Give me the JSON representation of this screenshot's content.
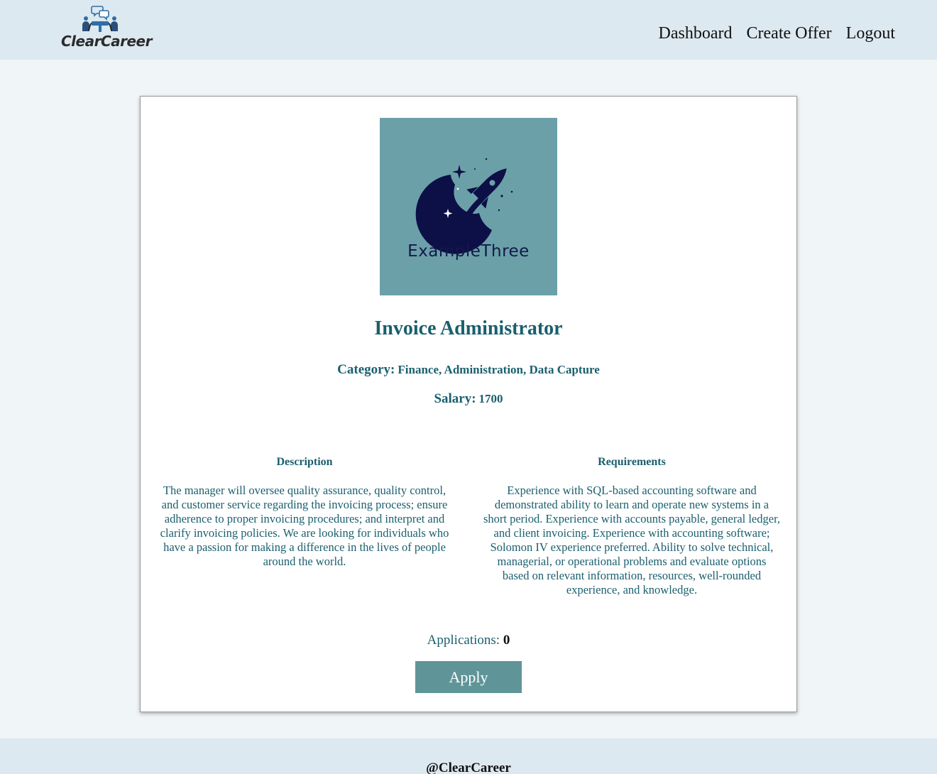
{
  "brand": {
    "name": "ClearCareer",
    "logo_icon": "people-chat-icon",
    "accent_color": "#2f6fa7"
  },
  "nav": {
    "items": [
      {
        "label": "Dashboard"
      },
      {
        "label": "Create Offer"
      },
      {
        "label": "Logout"
      }
    ]
  },
  "offer": {
    "company_logo_text": "ExampleThree",
    "company_logo_icon": "rocket-moon-icon",
    "company_logo_bg": "#6ba0a8",
    "title": "Invoice Administrator",
    "category_label": "Category:",
    "category_value": "Finance, Administration, Data Capture",
    "salary_label": "Salary:",
    "salary_value": "1700",
    "description_heading": "Description",
    "description_text": "The manager will oversee quality assurance, quality control, and customer service regarding the invoicing process; ensure adherence to proper invoicing procedures; and interpret and clarify invoicing policies. We are looking for individuals who have a passion for making a difference in the lives of people around the world.",
    "requirements_heading": "Requirements",
    "requirements_text": "Experience with SQL-based accounting software and demonstrated ability to learn and operate new systems in a short period. Experience with accounts payable, general ledger, and client invoicing. Experience with accounting software; Solomon IV experience preferred. Ability to solve technical, managerial, or operational problems and evaluate options based on relevant information, resources, well-rounded experience, and knowledge.",
    "applications_label": "Applications:",
    "applications_count": "0",
    "apply_label": "Apply",
    "text_color": "#1a5f6e",
    "button_color": "#5f9599"
  },
  "footer": {
    "text": "@ClearCareer"
  }
}
